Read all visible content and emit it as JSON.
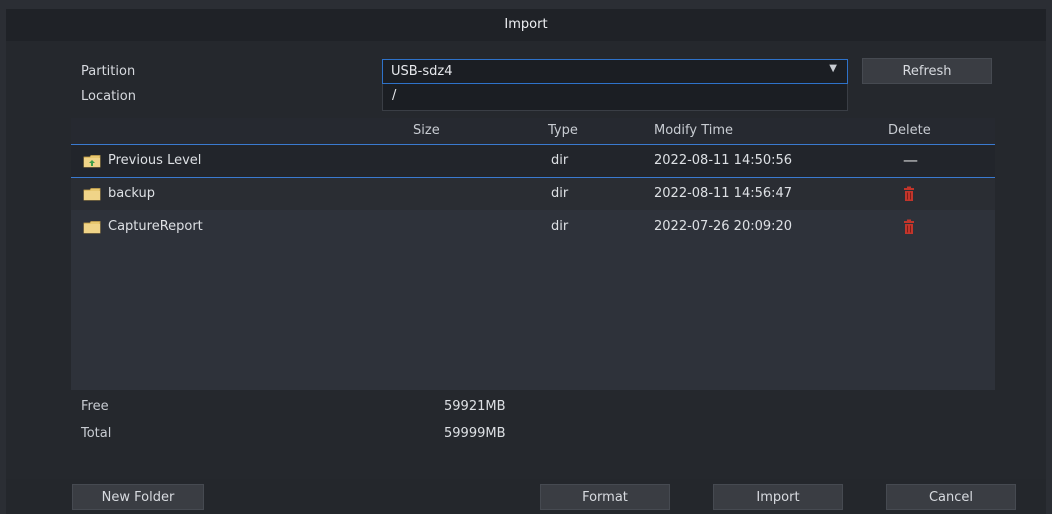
{
  "dialog": {
    "title": "Import"
  },
  "form": {
    "partition_label": "Partition",
    "partition_value": "USB-sdz4",
    "location_label": "Location",
    "location_value": "/",
    "refresh_label": "Refresh"
  },
  "table": {
    "columns": [
      "Size",
      "Type",
      "Modify Time",
      "Delete"
    ],
    "rows": [
      {
        "name": "Previous Level",
        "size": "",
        "type": "dir",
        "time": "2022-08-11 14:50:56",
        "delete": "—"
      },
      {
        "name": "backup",
        "size": "",
        "type": "dir",
        "time": "2022-08-11 14:56:47",
        "delete": "trash-icon"
      },
      {
        "name": "CaptureReport",
        "size": "",
        "type": "dir",
        "time": "2022-07-26 20:09:20",
        "delete": "trash-icon"
      }
    ]
  },
  "stats": {
    "free_label": "Free",
    "free_value": "59921MB",
    "total_label": "Total",
    "total_value": "59999MB"
  },
  "buttons": {
    "new_folder": "New Folder",
    "format": "Format",
    "import": "Import",
    "cancel": "Cancel"
  },
  "colors": {
    "accent": "#2e72c9",
    "trash": "#c2352b",
    "folder": "#e8c870"
  }
}
